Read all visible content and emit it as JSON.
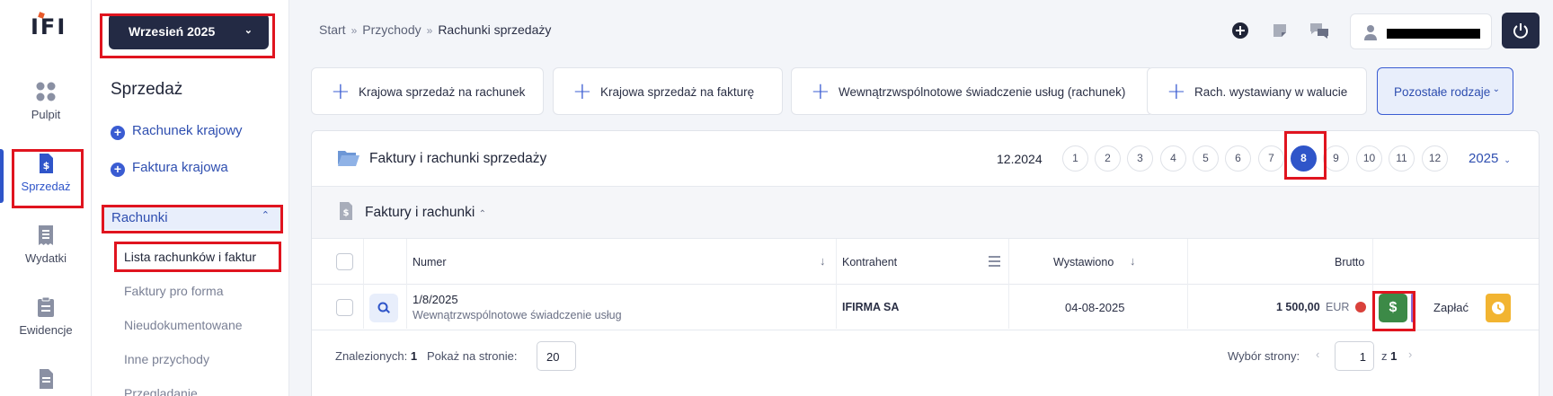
{
  "rail": {
    "items": [
      {
        "label": "Pulpit",
        "icon": "dashboard-icon"
      },
      {
        "label": "Sprzedaż",
        "icon": "invoice-dollar-icon"
      },
      {
        "label": "Wydatki",
        "icon": "receipt-icon"
      },
      {
        "label": "Ewidencje",
        "icon": "clipboard-icon"
      },
      {
        "label": "",
        "icon": "document-icon"
      }
    ]
  },
  "sidebar": {
    "month": "Wrzesień 2025",
    "title": "Sprzedaż",
    "links": [
      "Rachunek krajowy",
      "Faktura krajowa"
    ],
    "section": "Rachunki",
    "sub_items": [
      "Lista rachunków i faktur",
      "Faktury pro forma",
      "Nieudokumentowane",
      "Inne przychody",
      "Przeglądanie"
    ]
  },
  "breadcrumb": [
    "Start",
    "Przychody",
    "Rachunki sprzedaży"
  ],
  "type_buttons": [
    "Krajowa sprzedaż na rachunek",
    "Krajowa sprzedaż na fakturę",
    "Wewnątrzwspólnotowe świadczenie usług (rachunek)",
    "Rach. wystawiany w walucie",
    "Pozostałe rodzaje"
  ],
  "panel": {
    "title": "Faktury i rachunki sprzedaży",
    "period": "12.2024",
    "months": [
      "1",
      "2",
      "3",
      "4",
      "5",
      "6",
      "7",
      "8",
      "9",
      "10",
      "11",
      "12"
    ],
    "active_month": "8",
    "year": "2025"
  },
  "table": {
    "title": "Faktury i rachunki",
    "headers": {
      "numer": "Numer",
      "kontrahent": "Kontrahent",
      "wystawiono": "Wystawiono",
      "brutto": "Brutto"
    },
    "rows": [
      {
        "numer": "1/8/2025",
        "opis": "Wewnątrzwspólnotowe świadczenie usług",
        "kontrahent": "IFIRMA SA",
        "wystawiono": "04-08-2025",
        "kwota": "1 500,00",
        "waluta": "EUR",
        "akcja": "Zapłać",
        "pay_icon": "$"
      }
    ],
    "footer": {
      "found_label": "Znalezionych:",
      "found": "1",
      "per_page_label": "Pokaż na stronie:",
      "per_page": "20",
      "page_label": "Wybór strony:",
      "page": "1",
      "of": "z",
      "total_pages": "1"
    }
  },
  "colors": {
    "accent": "#2f55c9",
    "dark": "#232a44",
    "pay": "#3c8a47",
    "warn": "#f2b431",
    "status_dot": "#d9413b"
  }
}
